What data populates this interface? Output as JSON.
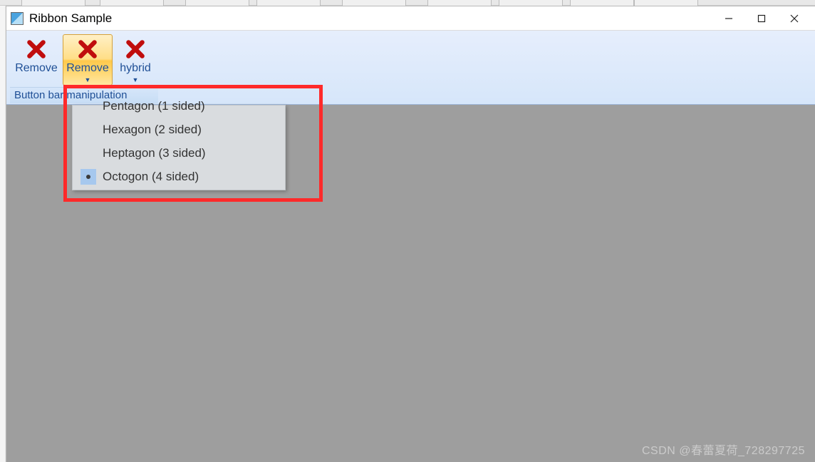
{
  "window": {
    "title": "Ribbon Sample"
  },
  "ribbon": {
    "buttons": {
      "remove1": "Remove",
      "remove2": "Remove",
      "hybrid": "hybrid"
    },
    "group_caption": "Button bar manipulation"
  },
  "dropdown": {
    "items": [
      {
        "label": "Pentagon (1 sided)"
      },
      {
        "label": "Hexagon (2 sided)"
      },
      {
        "label": "Heptagon (3 sided)"
      },
      {
        "label": "Octogon (4 sided)",
        "selected": true
      }
    ]
  },
  "watermark": "CSDN @春蕾夏荷_728297725"
}
